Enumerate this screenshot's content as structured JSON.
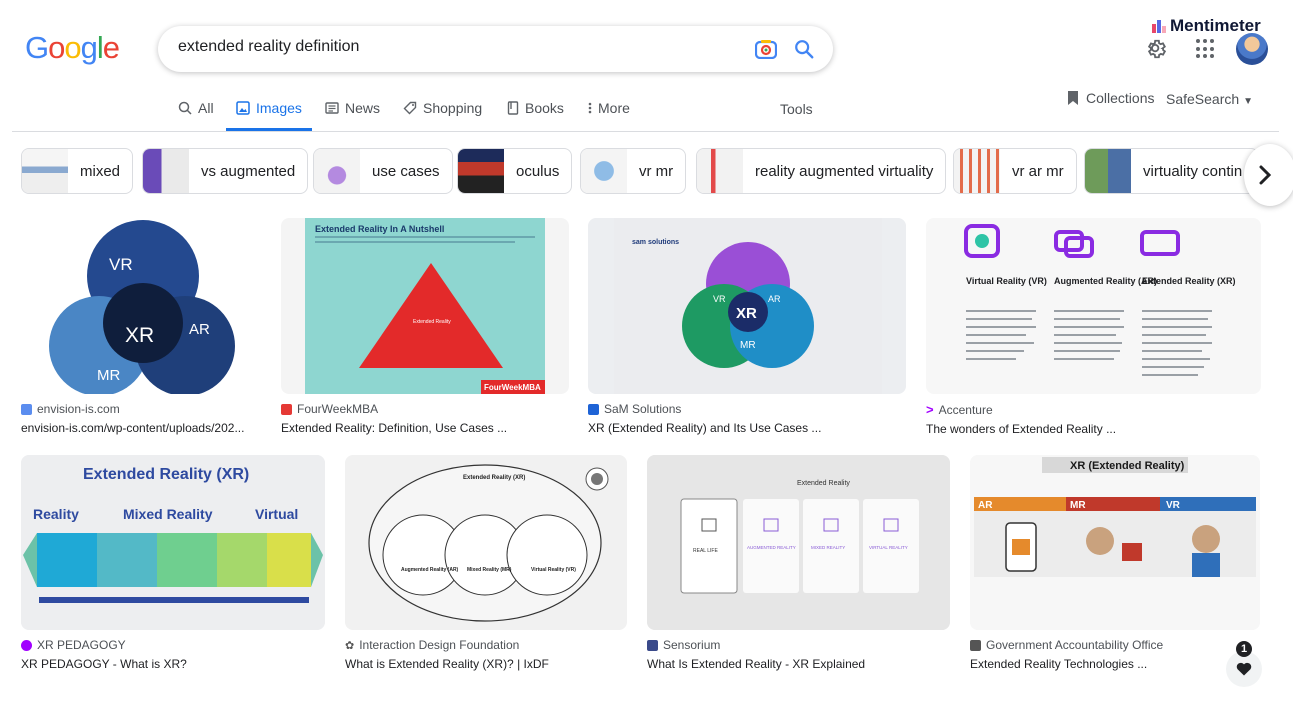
{
  "logo": [
    "G",
    "o",
    "o",
    "g",
    "l",
    "e"
  ],
  "logo_colors": [
    "#4285f4",
    "#ea4335",
    "#fbbc05",
    "#4285f4",
    "#34a853",
    "#ea4335"
  ],
  "search": {
    "value": "extended reality definition",
    "camera_icon": "camera-icon",
    "search_icon": "search-icon"
  },
  "header": {
    "extension": "Mentimeter",
    "gear_icon": "gear-icon",
    "apps_icon": "apps-icon"
  },
  "tabs": [
    {
      "label": "All",
      "icon": "search-icon"
    },
    {
      "label": "Images",
      "icon": "images-icon",
      "active": true
    },
    {
      "label": "News",
      "icon": "news-icon"
    },
    {
      "label": "Shopping",
      "icon": "tag-icon"
    },
    {
      "label": "Books",
      "icon": "book-icon"
    },
    {
      "label": "More",
      "icon": "more-icon"
    }
  ],
  "tools": "Tools",
  "collections": "Collections",
  "safesearch": "SafeSearch",
  "chips": [
    "mixed",
    "vs augmented",
    "use cases",
    "oculus",
    "vr mr",
    "reality augmented virtuality",
    "vr ar mr",
    "virtuality contin"
  ],
  "results": [
    {
      "source": "envision-is.com",
      "title": "envision-is.com/wp-content/uploads/202...",
      "fav_color": "#5b8def"
    },
    {
      "source": "FourWeekMBA",
      "title": "Extended Reality: Definition, Use Cases ...",
      "fav_color": "#e53935"
    },
    {
      "source": "SaM Solutions",
      "title": "XR (Extended Reality) and Its Use Cases ...",
      "fav_color": "#1e63d6"
    },
    {
      "source": "Accenture",
      "title": "The wonders of Extended Reality ...",
      "fav_color": "#a100ff"
    },
    {
      "source": "XR PEDAGOGY",
      "title": "XR PEDAGOGY - What is XR?",
      "fav_color": "#3a4a8a"
    },
    {
      "source": "Interaction Design Foundation",
      "title": "What is Extended Reality (XR)? | IxDF",
      "fav_color": "#555555"
    },
    {
      "source": "Sensorium",
      "title": "What Is Extended Reality - XR Explained",
      "fav_color": "#333333"
    },
    {
      "source": "Government Accountability Office",
      "title": "Extended Reality Technologies ...",
      "fav_color": "#1f4e9b"
    }
  ],
  "img_text": {
    "r1": {
      "vr": "VR",
      "xr": "XR",
      "ar": "AR",
      "mr": "MR"
    },
    "r2": {
      "title": "Extended Reality In A Nutshell",
      "brand": "FourWeekMBA",
      "center": "Extended Reality"
    },
    "r3": {
      "logo": "sam solutions",
      "xr": "XR",
      "vr": "VR",
      "ar": "AR",
      "mr": "MR"
    },
    "r4": {
      "c1": "Virtual Reality (VR)",
      "c2": "Augmented Reality (AR)",
      "c3": "Extended Reality (XR)"
    },
    "r5": {
      "title": "Extended Reality (XR)",
      "a": "Reality",
      "b": "Mixed Reality",
      "c": "Virtual"
    },
    "r6": {
      "title": "Extended Reality (XR)",
      "a": "Augmented Reality (AR)",
      "b": "Mixed Reality (MR)",
      "c": "Virtual Reality (VR)"
    },
    "r7": {
      "title": "Extended Reality",
      "a": "REAL LIFE",
      "b": "AUGMENTED REALITY",
      "c": "MIXED REALITY",
      "d": "VIRTUAL REALITY"
    },
    "r8": {
      "title": "XR (Extended Reality)",
      "a": "AR",
      "b": "MR",
      "c": "VR"
    }
  },
  "notification_count": "1",
  "heart_icon": "heart-icon"
}
